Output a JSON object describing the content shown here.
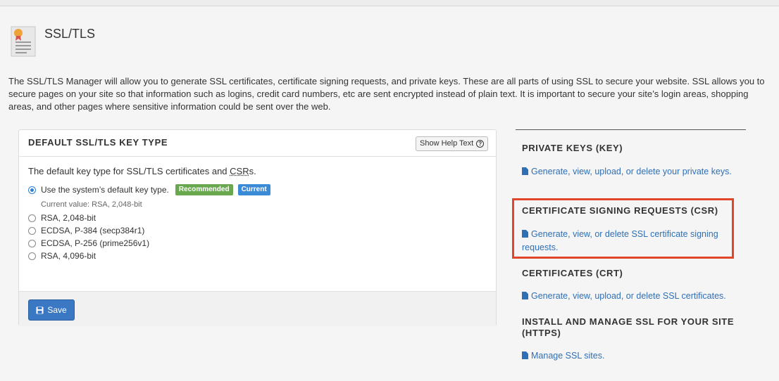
{
  "page": {
    "title": "SSL/TLS",
    "intro": "The SSL/TLS Manager will allow you to generate SSL certificates, certificate signing requests, and private keys. These are all parts of using SSL to secure your website. SSL allows you to secure pages on your site so that information such as logins, credit card numbers, etc are sent encrypted instead of plain text. It is important to secure your site’s login areas, shopping areas, and other pages where sensitive information could be sent over the web."
  },
  "key_panel": {
    "title": "DEFAULT SSL/TLS KEY TYPE",
    "help_button": "Show Help Text",
    "description_prefix": "The default key type for SSL/TLS certificates and ",
    "description_abbr": "CSR",
    "description_suffix": "s.",
    "options": [
      {
        "label": "Use the system’s default key type.",
        "checked": true
      },
      {
        "label": "RSA, 2,048-bit",
        "checked": false
      },
      {
        "label": "ECDSA, P-384 (secp384r1)",
        "checked": false
      },
      {
        "label": "ECDSA, P-256 (prime256v1)",
        "checked": false
      },
      {
        "label": "RSA, 4,096-bit",
        "checked": false
      }
    ],
    "badge_recommended": "Recommended",
    "badge_current": "Current",
    "current_value": "Current value: RSA, 2,048-bit",
    "save_label": "Save"
  },
  "sections": [
    {
      "title": "PRIVATE KEYS (KEY)",
      "link": "Generate, view, upload, or delete your private keys."
    },
    {
      "title": "CERTIFICATE SIGNING REQUESTS (CSR)",
      "link": "Generate, view, or delete SSL certificate signing requests."
    },
    {
      "title": "CERTIFICATES (CRT)",
      "link": "Generate, view, upload, or delete SSL certificates."
    },
    {
      "title": "INSTALL AND MANAGE SSL FOR YOUR SITE (HTTPS)",
      "link": "Manage SSL sites."
    }
  ],
  "colors": {
    "link": "#2f6fb5",
    "highlight": "#e0462a",
    "save_button": "#3a78c3",
    "recommended": "#6aa84f",
    "current": "#3a8ad6"
  }
}
